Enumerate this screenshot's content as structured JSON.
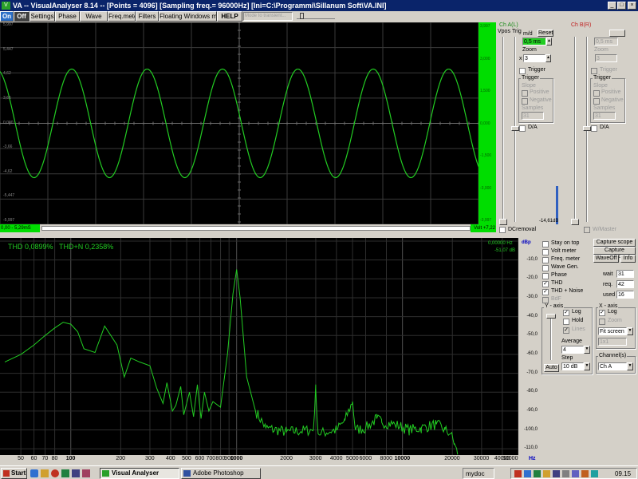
{
  "window": {
    "title": "VA -- VisualAnalyser 8.14 -- [Points = 4096] [Sampling freq.= 96000Hz] [Ini=C:\\Programmi\\Sillanum Soft\\VA.INI]",
    "icon": "va-icon",
    "min": "_",
    "max": "□",
    "close": "×"
  },
  "menu": {
    "on": "On",
    "off": "Off",
    "settings": "Settings",
    "phase": "Phase",
    "wave": "Wave",
    "freq_meter": "Freq.meter",
    "filters": "Filters",
    "floating": "Floating Windows mode",
    "help": "HELP",
    "combo_placeholder": "Mode to transient..."
  },
  "scope": {
    "left_ticks": [
      "5,997",
      "5,447",
      "4,62",
      "3,66",
      "0,000",
      "-3,66",
      "-4,62",
      "-5,447",
      "-5,997"
    ],
    "right_ticks": [
      "3,997",
      "3,000",
      "1,500",
      "0,000",
      "-1,500",
      "-3,000",
      "-3,997"
    ],
    "status_left": "0,00 - 5,29mS",
    "status_right": "Volt +7,22",
    "dc_level": "-14,61dB",
    "dcremoval": "DCremoval",
    "color": "#22cc22"
  },
  "cha": {
    "title": "Ch A(L)",
    "vpos": "Vpos",
    "trig": "Trig",
    "ms_d": "m/d",
    "reset": "Reset",
    "ms_value": "0,5 ms",
    "zoom": "Zoom",
    "zoom_x": "x",
    "zoom_value": "3",
    "trigger": "Trigger",
    "trigger_grp": "Trigger",
    "slope": "Slope",
    "positive": "Positive",
    "negative": "Negative",
    "samples": "Samples",
    "samples_value": "31",
    "da": "D/A"
  },
  "chb": {
    "title": "Ch B(R)",
    "ms_value": "0,5 ms",
    "zoom": "Zoom",
    "zoom_value": "3",
    "trigger": "Trigger",
    "trigger_grp": "Trigger",
    "slope": "Slope",
    "positive": "Positive",
    "negative": "Negative",
    "samples": "Samples",
    "samples_value": "31",
    "da": "D/A",
    "mvmaster": "W/Master"
  },
  "spectrum": {
    "thd": "THD 0,0899%",
    "thdn": "THD+N 0,2358%",
    "freq_readout": "0,00000 Hz",
    "db_readout": "-51,07 dB",
    "unit": "dBp",
    "y_ticks": [
      "-10,0",
      "-20,0",
      "-30,0",
      "-40,0",
      "-50,0",
      "-60,0",
      "-70,0",
      "-80,0",
      "-90,0",
      "-100,0",
      "-110,0"
    ],
    "x_ticks": [
      {
        "v": 50,
        "t": "50",
        "b": false
      },
      {
        "v": 60,
        "t": "60",
        "b": false
      },
      {
        "v": 70,
        "t": "70",
        "b": false
      },
      {
        "v": 80,
        "t": "80",
        "b": false
      },
      {
        "v": 100,
        "t": "100",
        "b": true
      },
      {
        "v": 200,
        "t": "200",
        "b": false
      },
      {
        "v": 300,
        "t": "300",
        "b": false
      },
      {
        "v": 400,
        "t": "400",
        "b": false
      },
      {
        "v": 500,
        "t": "500",
        "b": false
      },
      {
        "v": 600,
        "t": "600",
        "b": false
      },
      {
        "v": 700,
        "t": "700",
        "b": false
      },
      {
        "v": 800,
        "t": "800",
        "b": false
      },
      {
        "v": 900,
        "t": "900",
        "b": false
      },
      {
        "v": 1000,
        "t": "1000",
        "b": true
      },
      {
        "v": 2000,
        "t": "2000",
        "b": false
      },
      {
        "v": 3000,
        "t": "3000",
        "b": false
      },
      {
        "v": 4000,
        "t": "4000",
        "b": false
      },
      {
        "v": 5000,
        "t": "5000",
        "b": false
      },
      {
        "v": 6000,
        "t": "6000",
        "b": false
      },
      {
        "v": 8000,
        "t": "8000",
        "b": false
      },
      {
        "v": 10000,
        "t": "10000",
        "b": true
      },
      {
        "v": 20000,
        "t": "20000",
        "b": false
      },
      {
        "v": 30000,
        "t": "30000",
        "b": false
      },
      {
        "v": 40000,
        "t": "40000",
        "b": false
      },
      {
        "v": 50000,
        "t": "50000",
        "b": false
      }
    ],
    "hz": "Hz",
    "color": "#22cc22"
  },
  "chart_data": {
    "type": "line",
    "xlabel": "Hz",
    "ylabel": "dBp",
    "xscale": "log",
    "xlim": [
      40,
      50000
    ],
    "ylim": [
      -115,
      0
    ],
    "series": [
      {
        "values": [
          [
            40,
            -64
          ],
          [
            50,
            -60
          ],
          [
            60,
            -55
          ],
          [
            70,
            -50
          ],
          [
            80,
            -46
          ],
          [
            90,
            -43
          ],
          [
            100,
            -44
          ],
          [
            110,
            -48
          ],
          [
            120,
            -57
          ],
          [
            140,
            -59
          ],
          [
            160,
            -45
          ],
          [
            190,
            -55
          ],
          [
            210,
            -72
          ],
          [
            230,
            -62
          ],
          [
            260,
            -64
          ],
          [
            300,
            -66
          ],
          [
            330,
            -78
          ],
          [
            360,
            -86
          ],
          [
            380,
            -75
          ],
          [
            410,
            -90
          ],
          [
            430,
            -87
          ],
          [
            460,
            -77
          ],
          [
            480,
            -92
          ],
          [
            520,
            -80
          ],
          [
            550,
            -93
          ],
          [
            580,
            -76
          ],
          [
            610,
            -94
          ],
          [
            640,
            -80
          ],
          [
            680,
            -90
          ],
          [
            720,
            -85
          ],
          [
            800,
            -88
          ],
          [
            880,
            -60
          ],
          [
            950,
            -28
          ],
          [
            1000,
            -15
          ],
          [
            1050,
            -30
          ],
          [
            1150,
            -72
          ],
          [
            1300,
            -90
          ],
          [
            1500,
            -99
          ],
          [
            2000,
            -101
          ],
          [
            2900,
            -100
          ],
          [
            3000,
            -78
          ],
          [
            3100,
            -102
          ],
          [
            4000,
            -100
          ],
          [
            4500,
            -95
          ],
          [
            5000,
            -85
          ],
          [
            5200,
            -100
          ],
          [
            6000,
            -99
          ],
          [
            7000,
            -94
          ],
          [
            7500,
            -96
          ],
          [
            9000,
            -97
          ],
          [
            11000,
            -100
          ],
          [
            13000,
            -99
          ],
          [
            16000,
            -97
          ],
          [
            18000,
            -100
          ],
          [
            19500,
            -102
          ],
          [
            20500,
            -107
          ],
          [
            21500,
            -113
          ]
        ]
      }
    ]
  },
  "controls": {
    "stay_on_top": "Stay on top",
    "volt_meter": "Volt meter",
    "freq_meter": "Freq. meter",
    "wave_gen": "Wave Gen.",
    "phase": "Phase",
    "thd": "THD",
    "thd_noise": "THD + Noise",
    "bdf": "BdF",
    "capture_scope": "Capture scope",
    "capture_spectrum": "Capture spectrum",
    "waveoff": "WaveOff",
    "info": "Info",
    "wait": "wait",
    "wait_v": "31",
    "req": "req.",
    "req_v": "42",
    "used": "used",
    "used_v": "16",
    "yaxis": "Y - axis",
    "log": "Log",
    "hold": "Hold",
    "lines": "Lines",
    "average": "Average",
    "average_v": "4",
    "step": "Step",
    "step_v": "10 dB",
    "auto": "Auto",
    "xaxis": "X - axis",
    "xlog": "Log",
    "zoom": "Zoom",
    "fit": "Fit screen",
    "xval": "1x1",
    "channels": "Channel(s)",
    "channel_v": "Ch A"
  },
  "taskbar": {
    "start": "Start",
    "task1": "Visual Analyser",
    "task2": "Adobe Photoshop",
    "tray_text": "mydoc",
    "clock": "09.15"
  }
}
